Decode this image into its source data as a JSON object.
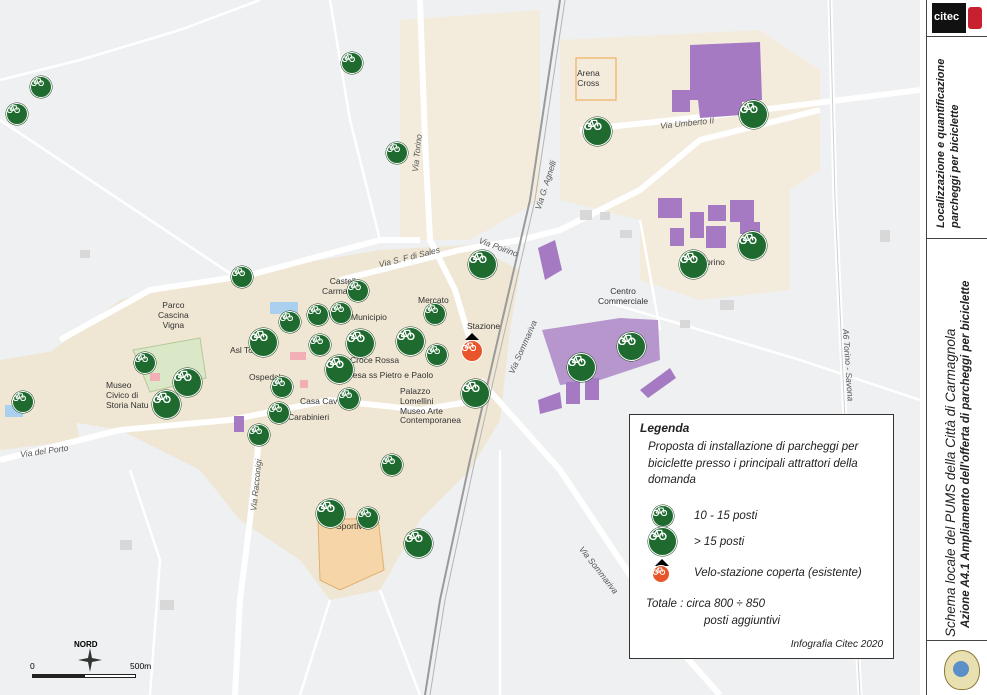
{
  "map": {
    "place_labels": {
      "arena_cross": "Arena\nCross",
      "centro_commerciale": "Centro\nCommerciale",
      "parco_cascina_vigna": "Parco\nCascina\nVigna",
      "castello": "Castello\nCarmagnola",
      "mercato": "Mercato",
      "municipio": "Municipio",
      "stazione": "Stazione",
      "asl": "Asl To",
      "croce_rossa": "Croce Rossa",
      "chiesa": "Chiesa ss Pietro e Paolo",
      "ospedale": "Ospedale",
      "museo_civico": "Museo\nCivico di\nStoria Natu",
      "casa_cav": "Casa Cav",
      "carabinieri": "Carabinieri",
      "palazzo_lomellini": "Palazzo\nLomellini\nMuseo Arte\nContemporanea",
      "sportivo": "Sportivo",
      "torino_frag": "orino"
    },
    "road_labels": {
      "via_torino": "Via Torino",
      "via_umberto": "Via Umberto II",
      "via_g_agnelli": "Via G. Agnelli",
      "via_s_f_di_sales": "Via S. F di Sales",
      "via_poirino": "Via Poirino",
      "via_sommariva_1": "Via Sommariva",
      "via_sommariva_2": "Via Sommariva",
      "via_racconigi": "Via Racconigi",
      "via_del_porto": "Via del Porto",
      "a6": "A6 Torino - Savona"
    },
    "scale": {
      "start": "0",
      "end": "500m",
      "north": "NORD"
    }
  },
  "legend": {
    "title": "Legenda",
    "description": "Proposta di installazione di parcheggi per biciclette presso i principali attrattori della domanda",
    "small": "10 - 15 posti",
    "large": "> 15 posti",
    "velo": "Velo-stazione coperta (esistente)",
    "total_line1": "Totale : circa 800 ÷ 850",
    "total_line2": "posti aggiuntivi",
    "credit": "Infografia Citec 2020"
  },
  "sidebar": {
    "title_main": "Schema locale del PUMS della Città di Carmagnola",
    "title_sub": "Azione A4.1 Ampliamento dell'offerta di parcheggi per biciclette",
    "section_title": "Localizzazione e quantificazione\nparcheggi per biciclette",
    "logo_text": "citec"
  },
  "colors": {
    "pin_green": "#1f6b2f",
    "velo_orange": "#e8552a",
    "industrial_purple": "#a57ac2",
    "urban_beige": "#efe6d3"
  }
}
